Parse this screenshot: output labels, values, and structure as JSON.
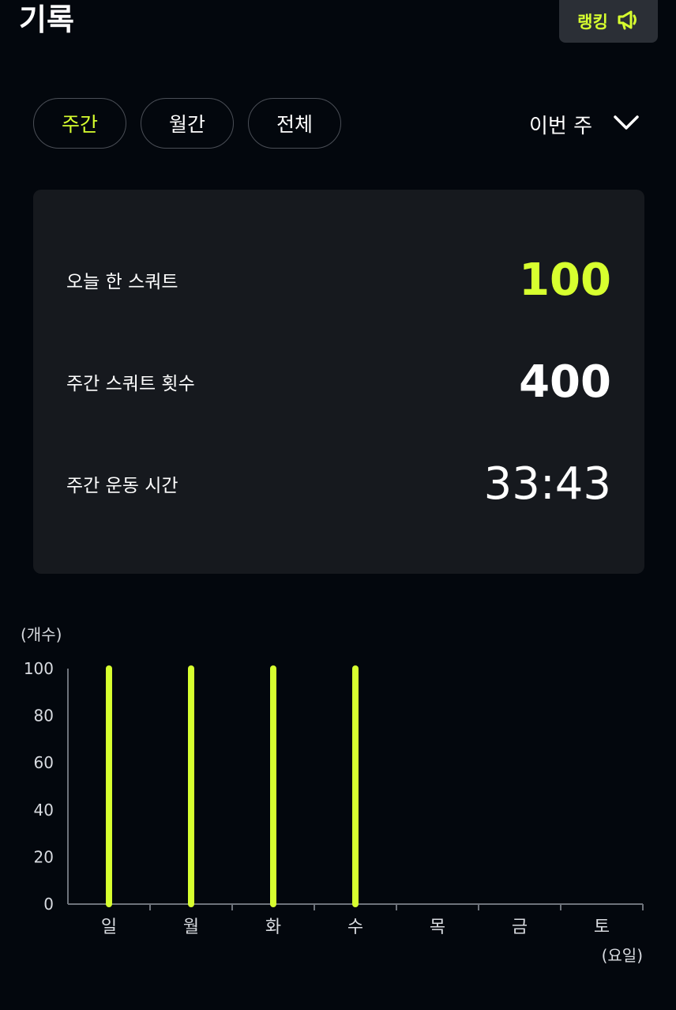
{
  "header": {
    "title": "기록",
    "ranking_label": "랭킹"
  },
  "tabs": [
    {
      "label": "주간",
      "active": true
    },
    {
      "label": "월간",
      "active": false
    },
    {
      "label": "전체",
      "active": false
    }
  ],
  "period": {
    "selected": "이번 주"
  },
  "stats": {
    "today_label": "오늘 한 스쿼트",
    "today_value": "100",
    "weekly_count_label": "주간 스쿼트 횟수",
    "weekly_count_value": "400",
    "weekly_time_label": "주간 운동 시간",
    "weekly_time_value": "33:43"
  },
  "colors": {
    "accent": "#d7ff2f",
    "background": "#03070d",
    "card": "#16191e"
  },
  "icons": {
    "ranking": "megaphone-icon",
    "period": "chevron-down-icon"
  },
  "chart_data": {
    "type": "bar",
    "categories": [
      "일",
      "월",
      "화",
      "수",
      "목",
      "금",
      "토"
    ],
    "values": [
      100,
      100,
      100,
      100,
      0,
      0,
      0
    ],
    "ylabel": "(개수)",
    "xlabel": "(요일)",
    "ylim": [
      0,
      100
    ],
    "yticks": [
      0,
      20,
      40,
      60,
      80,
      100
    ]
  }
}
